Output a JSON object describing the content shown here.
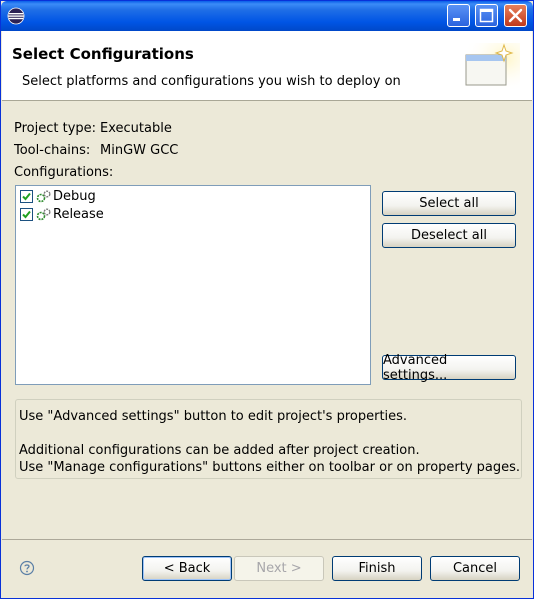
{
  "window": {
    "minimize_label": "_",
    "maximize_label": "",
    "close_label": ""
  },
  "header": {
    "title": "Select Configurations",
    "description": "Select platforms and configurations you wish to deploy on"
  },
  "info": {
    "project_type_label": "Project type:",
    "project_type_value": "Executable",
    "toolchains_label": "Tool-chains:",
    "toolchains_value": "MinGW GCC",
    "configurations_label": "Configurations:"
  },
  "configurations": [
    {
      "label": "Debug",
      "checked": true
    },
    {
      "label": "Release",
      "checked": true
    }
  ],
  "buttons": {
    "select_all": "Select all",
    "deselect_all": "Deselect all",
    "advanced_settings": "Advanced settings...",
    "back": "< Back",
    "next": "Next >",
    "finish": "Finish",
    "cancel": "Cancel"
  },
  "hints": {
    "line1": "Use \"Advanced settings\" button to edit project's properties.",
    "line2": "Additional configurations can be added after project creation.",
    "line3": "Use \"Manage configurations\" buttons either on toolbar or on property pages."
  },
  "colors": {
    "titlebar": "#0055e5",
    "dialog_bg": "#ece9d8",
    "button_border": "#003c74",
    "check_green": "#21a121"
  }
}
